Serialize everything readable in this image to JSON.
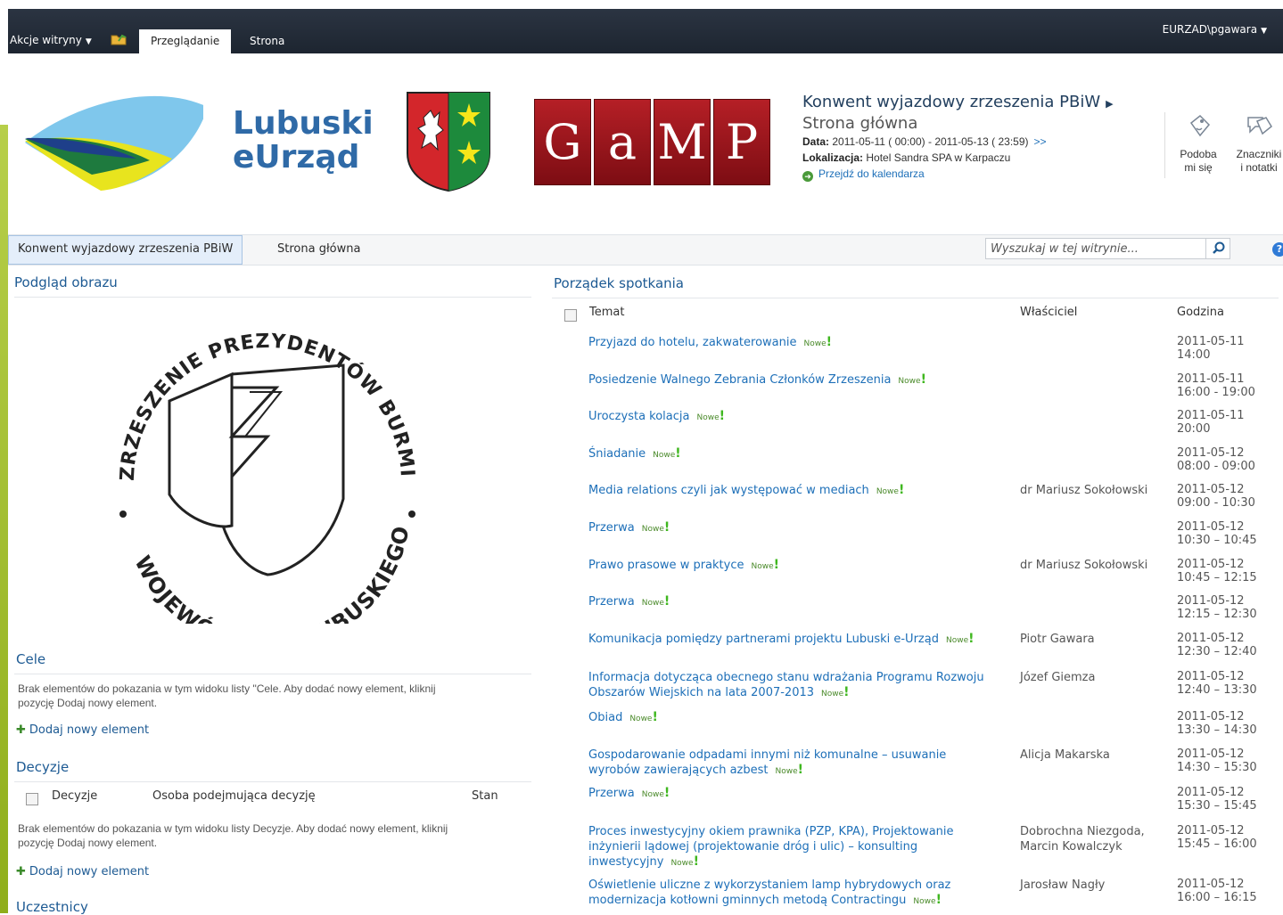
{
  "ribbon": {
    "site_actions": "Akcje witryny",
    "tab_browse": "Przeglądanie",
    "tab_page": "Strona",
    "user": "EURZAD\\pgawara"
  },
  "header": {
    "logo_line1": "Lubuski",
    "logo_line2": "eUrząd",
    "gamp_letters": [
      "G",
      "a",
      "M",
      "P"
    ],
    "site_title": "Konwent wyjazdowy zrzeszenia PBiW",
    "page_title": "Strona główna",
    "date_label": "Data:",
    "date_value": "2011-05-11 ( 00:00) - 2011-05-13 ( 23:59)",
    "date_more": ">>",
    "location_label": "Lokalizacja:",
    "location_value": "Hotel Sandra SPA w Karpaczu",
    "calendar_link": "Przejdź do kalendarza",
    "like_line1": "Podoba",
    "like_line2": "mi się",
    "tags_line1": "Znaczniki",
    "tags_line2": "i notatki"
  },
  "nav": {
    "item1": "Konwent wyjazdowy zrzeszenia PBiW",
    "item2": "Strona główna",
    "search_placeholder": "Wyszukaj w tej witrynie..."
  },
  "left": {
    "image_preview_title": "Podgląd obrazu",
    "emblem_top_text": "ZRZESZENIE PREZYDENTÓW BURMISTRZÓW I WÓJTÓW",
    "emblem_bottom_text": "WOJEWÓDZTWA LUBUSKIEGO",
    "goals_title": "Cele",
    "goals_empty_line1": "Brak elementów do pokazania w tym widoku listy \"Cele. Aby dodać nowy element, kliknij",
    "goals_empty_line2": "pozycję Dodaj nowy element.",
    "add_new": "Dodaj nowy element",
    "decisions_title": "Decyzje",
    "decisions_col1": "Decyzje",
    "decisions_col2": "Osoba podejmująca decyzję",
    "decisions_col3": "Stan",
    "decisions_empty_line1": "Brak elementów do pokazania w tym widoku listy Decyzje. Aby dodać nowy element, kliknij",
    "decisions_empty_line2": "pozycję Dodaj nowy element.",
    "participants_title": "Uczestnicy"
  },
  "agenda": {
    "title": "Porządek spotkania",
    "col_topic": "Temat",
    "col_owner": "Właściciel",
    "col_time": "Godzina",
    "new_label": "Nowe",
    "rows": [
      {
        "topic": "Przyjazd do hotelu, zakwaterowanie",
        "owner": "",
        "date": "2011-05-11",
        "time": "14:00"
      },
      {
        "topic": "Posiedzenie Walnego Zebrania Członków Zrzeszenia",
        "owner": "",
        "date": "2011-05-11",
        "time": "16:00 - 19:00"
      },
      {
        "topic": "Uroczysta kolacja",
        "owner": "",
        "date": "2011-05-11",
        "time": "20:00"
      },
      {
        "topic": "Śniadanie",
        "owner": "",
        "date": "2011-05-12",
        "time": "08:00 - 09:00"
      },
      {
        "topic": "Media relations czyli jak występować w mediach",
        "owner": "dr Mariusz Sokołowski",
        "date": "2011-05-12",
        "time": "09:00 - 10:30"
      },
      {
        "topic": "Przerwa",
        "owner": "",
        "date": "2011-05-12",
        "time": "10:30 – 10:45"
      },
      {
        "topic": "Prawo prasowe w praktyce",
        "owner": "dr Mariusz Sokołowski",
        "date": "2011-05-12",
        "time": "10:45 – 12:15"
      },
      {
        "topic": "Przerwa",
        "owner": "",
        "date": "2011-05-12",
        "time": "12:15 – 12:30"
      },
      {
        "topic": "Komunikacja pomiędzy partnerami projektu Lubuski e-Urząd",
        "owner": "Piotr Gawara",
        "date": "2011-05-12",
        "time": "12:30 – 12:40"
      },
      {
        "topic": "Informacja dotycząca obecnego stanu wdrażania Programu Rozwoju Obszarów Wiejskich na lata 2007-2013",
        "owner": "Józef Giemza",
        "date": "2011-05-12",
        "time": "12:40 – 13:30"
      },
      {
        "topic": "Obiad",
        "owner": "",
        "date": "2011-05-12",
        "time": "13:30 – 14:30"
      },
      {
        "topic": "Gospodarowanie odpadami innymi niż komunalne – usuwanie wyrobów zawierających azbest",
        "owner": "Alicja Makarska",
        "date": "2011-05-12",
        "time": "14:30 – 15:30"
      },
      {
        "topic": "Przerwa",
        "owner": "",
        "date": "2011-05-12",
        "time": "15:30 – 15:45"
      },
      {
        "topic": "Proces inwestycyjny okiem prawnika (PZP, KPA), Projektowanie inżynierii lądowej (projektowanie dróg i ulic) – konsulting inwestycyjny",
        "owner": "Dobrochna Niezgoda, Marcin Kowalczyk",
        "date": "2011-05-12",
        "time": "15:45 – 16:00"
      },
      {
        "topic": "Oświetlenie uliczne z wykorzystaniem lamp hybrydowych oraz modernizacja kotłowni gminnych metodą Contractingu",
        "owner": "Jarosław Nagły",
        "date": "2011-05-12",
        "time": "16:00 – 16:15"
      }
    ]
  }
}
